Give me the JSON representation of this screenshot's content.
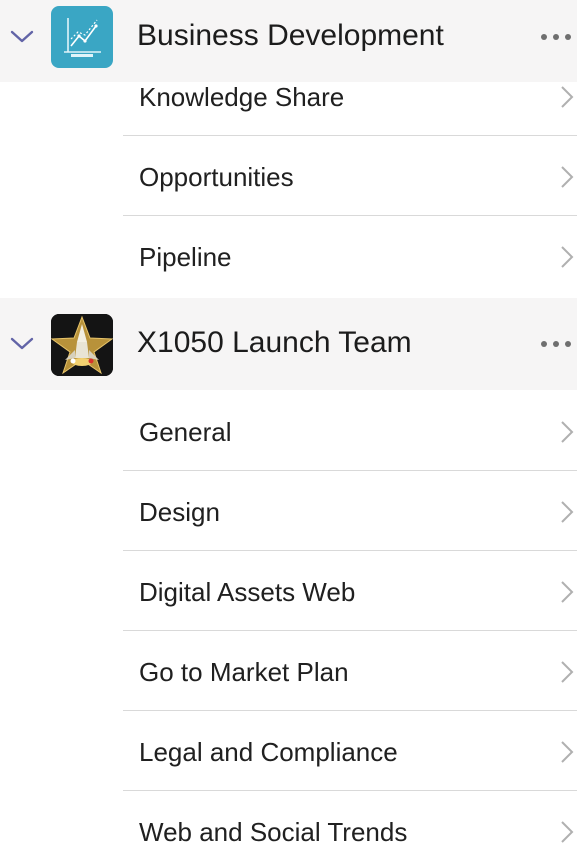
{
  "teams": [
    {
      "name": "Business Development",
      "avatar_icon": "line-chart-icon",
      "avatar_color": "#3aa6c4",
      "channels": [
        {
          "label": "Knowledge Share"
        },
        {
          "label": "Opportunities"
        },
        {
          "label": "Pipeline"
        }
      ]
    },
    {
      "name": "X1050 Launch Team",
      "avatar_icon": "rocket-star-icon",
      "avatar_color": "#1a1a1a",
      "channels": [
        {
          "label": "General"
        },
        {
          "label": "Design"
        },
        {
          "label": "Digital Assets Web"
        },
        {
          "label": "Go to Market Plan"
        },
        {
          "label": "Legal and Compliance"
        },
        {
          "label": "Web and Social Trends"
        }
      ]
    }
  ],
  "colors": {
    "accent_chevron": "#6264a7",
    "row_chevron": "#b0b0b0",
    "header_bg": "#f6f5f5",
    "divider": "#d9d9d9"
  }
}
